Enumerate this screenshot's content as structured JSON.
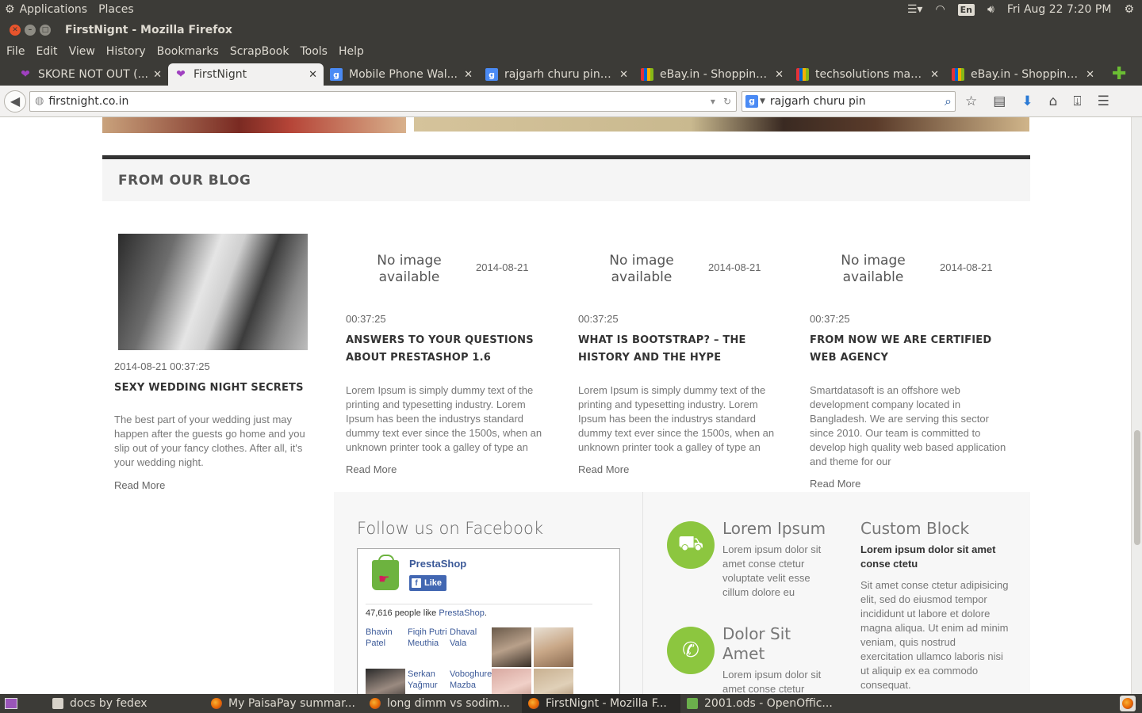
{
  "top_panel": {
    "applications": "Applications",
    "places": "Places",
    "lang": "En",
    "datetime": "Fri Aug 22  7:20 PM"
  },
  "window": {
    "title": "FirstNignt - Mozilla Firefox"
  },
  "menu": [
    "File",
    "Edit",
    "View",
    "History",
    "Bookmarks",
    "ScrapBook",
    "Tools",
    "Help"
  ],
  "tabs": [
    {
      "label": "SKORE NOT OUT (...",
      "favicon": "heart-icon"
    },
    {
      "label": "FirstNignt",
      "favicon": "heart-icon",
      "active": true
    },
    {
      "label": "Mobile Phone Wal...",
      "favicon": "google-icon"
    },
    {
      "label": "rajgarh churu pin - ...",
      "favicon": "google-icon"
    },
    {
      "label": "eBay.in - Shopping...",
      "favicon": "ebay-icon"
    },
    {
      "label": "techsolutions man...",
      "favicon": "ebay-icon"
    },
    {
      "label": "eBay.in - Shopping...",
      "favicon": "ebay-icon"
    }
  ],
  "nav": {
    "url": "firstnight.co.in",
    "search_value": "rajgarh churu pin"
  },
  "blog": {
    "heading": "FROM OUR BLOG",
    "no_image_text": "No image available",
    "posts": [
      {
        "datetime": "2014-08-21 00:37:25",
        "title": "SEXY WEDDING NIGHT SECRETS",
        "excerpt": "The best part of your wedding just may happen after the guests go home and you slip out of your fancy clothes. After all, it's your wedding night.",
        "read_more": "Read More"
      },
      {
        "date": "2014-08-21",
        "time": "00:37:25",
        "title": "ANSWERS TO YOUR QUESTIONS ABOUT PRESTASHOP 1.6",
        "excerpt": "Lorem Ipsum is simply dummy text of the printing and typesetting industry. Lorem Ipsum has been the industrys standard dummy text ever since the 1500s, when an unknown printer took a galley of type an",
        "read_more": "Read More"
      },
      {
        "date": "2014-08-21",
        "time": "00:37:25",
        "title": "WHAT IS BOOTSTRAP? – THE HISTORY AND THE HYPE",
        "excerpt": "Lorem Ipsum is simply dummy text of the printing and typesetting industry. Lorem Ipsum has been the industrys standard dummy text ever since the 1500s, when an unknown printer took a galley of type an",
        "read_more": "Read More"
      },
      {
        "date": "2014-08-21",
        "time": "00:37:25",
        "title": "FROM NOW WE ARE CERTIFIED WEB AGENCY",
        "excerpt": "Smartdatasoft is an offshore web development company located in Bangladesh. We are serving this sector since 2010. Our team is committed to develop high quality web based application and theme for our",
        "read_more": "Read More"
      }
    ]
  },
  "facebook": {
    "heading": "Follow us on Facebook",
    "page_name": "PrestaShop",
    "like_label": "Like",
    "count_text": "47,616 people like ",
    "count_link": "PrestaShop",
    "count_end": ".",
    "friends": [
      "Bhavin Patel",
      "Fiqih Putri Meuthia",
      "Dhaval Vala",
      "Serkan Yağmur",
      "Voboghure Mazba"
    ]
  },
  "contact": [
    {
      "icon": "truck-icon",
      "title": "Lorem Ipsum",
      "text": "Lorem ipsum dolor sit amet conse ctetur voluptate velit esse cillum dolore eu"
    },
    {
      "icon": "phone-icon",
      "title": "Dolor Sit Amet",
      "text": "Lorem ipsum dolor sit amet conse ctetur"
    }
  ],
  "custom_block": {
    "title": "Custom Block",
    "subtitle": "Lorem ipsum dolor sit amet conse ctetu",
    "text": "Sit amet conse ctetur adipisicing elit, sed do eiusmod tempor incididunt ut labore et dolore magna aliqua. Ut enim ad minim veniam, quis nostrud exercitation ullamco laboris nisi ut aliquip ex ea commodo consequat."
  },
  "taskbar": [
    {
      "label": "docs  by  fedex",
      "icon": "document-icon"
    },
    {
      "label": "My PaisaPay summar...",
      "icon": "firefox-icon"
    },
    {
      "label": "long dimm vs sodim...",
      "icon": "firefox-icon"
    },
    {
      "label": "FirstNignt - Mozilla F...",
      "icon": "firefox-icon",
      "active": true
    },
    {
      "label": "2001.ods - OpenOffic...",
      "icon": "spreadsheet-icon"
    }
  ]
}
